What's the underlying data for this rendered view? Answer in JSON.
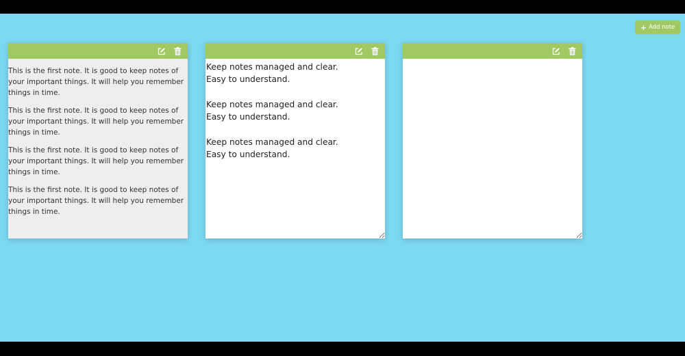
{
  "toolbar": {
    "add_note_label": "Add note",
    "add_note_icon": "plus-icon"
  },
  "colors": {
    "background": "#7dd8f1",
    "accent": "#a0c964",
    "note_view_bg": "#eeeeee",
    "note_edit_bg": "#ffffff"
  },
  "notes": [
    {
      "mode": "view",
      "icons": [
        "edit-icon",
        "trash-icon"
      ],
      "paragraphs": [
        "This is the first note. It is good to keep notes of your important things. It will help you remember things in time.",
        "This is the first note. It is good to keep notes of your important things. It will help you remember things in time.",
        "This is the first note. It is good to keep notes of your important things. It will help you remember things in time.",
        "This is the first note. It is good to keep notes of your important things. It will help you remember things in time."
      ]
    },
    {
      "mode": "edit",
      "icons": [
        "edit-icon",
        "trash-icon"
      ],
      "text": "Keep notes managed and clear.\nEasy to understand.\n\nKeep notes managed and clear.\nEasy to understand.\n\nKeep notes managed and clear.\nEasy to understand."
    },
    {
      "mode": "edit",
      "icons": [
        "edit-icon",
        "trash-icon"
      ],
      "text": ""
    }
  ]
}
